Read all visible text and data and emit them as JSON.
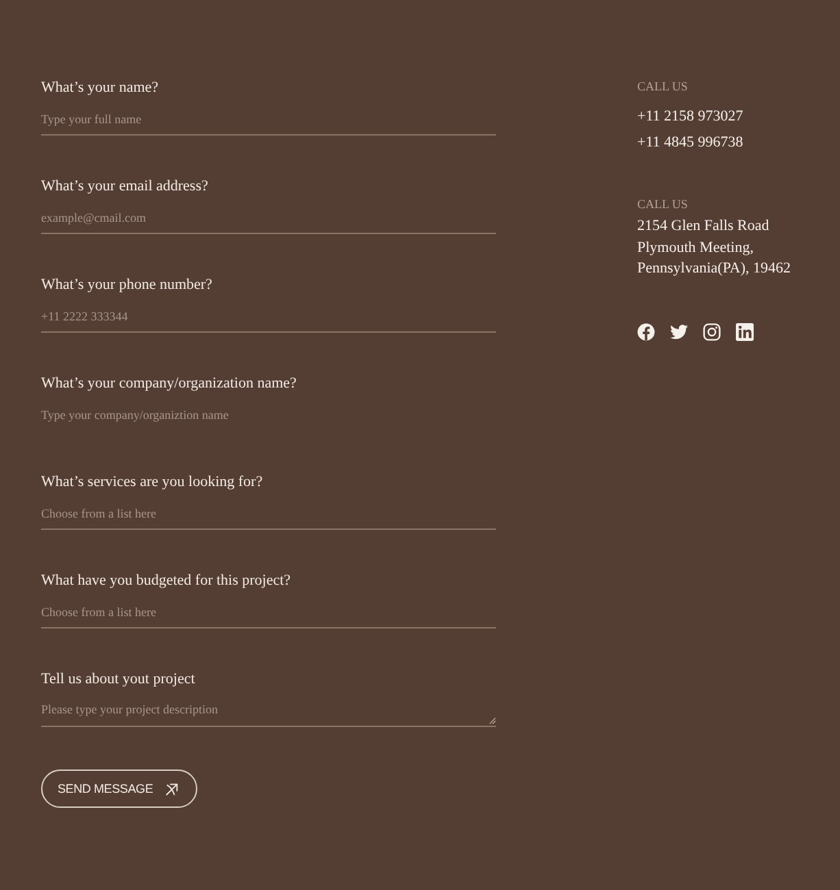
{
  "form": {
    "fields": [
      {
        "label": "What’s your name?",
        "placeholder": "Type your full name",
        "kind": "text",
        "underlined": true
      },
      {
        "label": "What’s your email address?",
        "placeholder": "example@cmail.com",
        "kind": "text",
        "underlined": true
      },
      {
        "label": "What’s your phone number?",
        "placeholder": "+11 2222 333344",
        "kind": "text",
        "underlined": true
      },
      {
        "label": "What’s your company/organization name?",
        "placeholder": "Type your company/organiztion name",
        "kind": "text",
        "underlined": false
      },
      {
        "label": "What’s services are you looking for?",
        "placeholder": "Choose from a list here",
        "kind": "select",
        "underlined": true
      },
      {
        "label": "What have you budgeted for this project?",
        "placeholder": "Choose from a list here",
        "kind": "select",
        "underlined": true
      },
      {
        "label": "Tell us about yout project",
        "placeholder": "Please type your project description",
        "kind": "textarea",
        "underlined": true
      }
    ],
    "submit": {
      "label": "SEND MESSAGE"
    }
  },
  "contact": [
    {
      "heading": "CALL US",
      "kind": "phones",
      "lines": [
        "+11 2158 973027",
        "+11 4845 996738"
      ]
    },
    {
      "heading": "CALL US",
      "kind": "address",
      "lines": [
        "2154 Glen Falls Road",
        "Plymouth Meeting,",
        "Pennsylvania(PA), 19462"
      ]
    }
  ],
  "social": [
    {
      "kind": "facebook"
    },
    {
      "kind": "twitter"
    },
    {
      "kind": "instagram"
    },
    {
      "kind": "linkedin"
    }
  ]
}
